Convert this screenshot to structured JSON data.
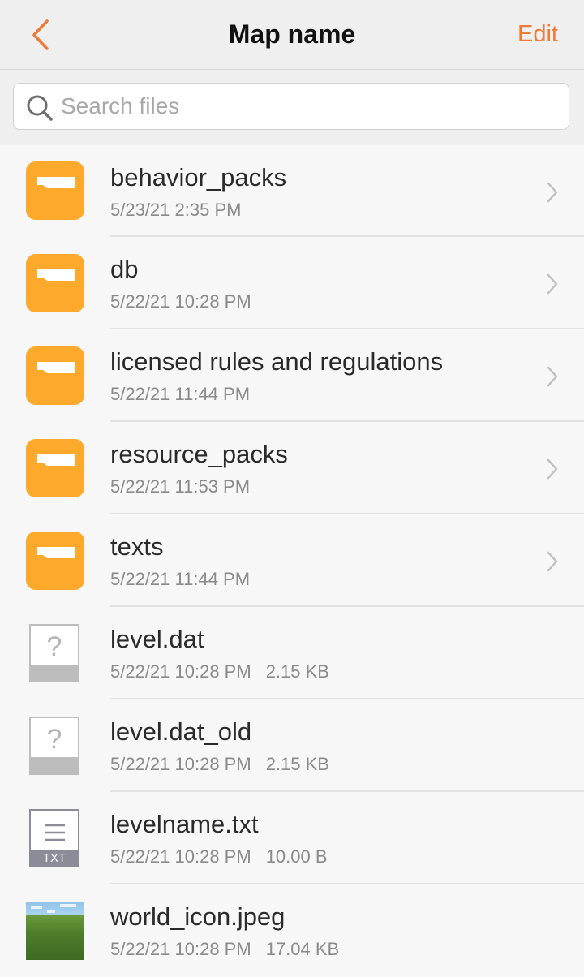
{
  "navbar": {
    "title": "Map name",
    "edit_label": "Edit",
    "accent_color": "#ee7a38"
  },
  "search": {
    "placeholder": "Search files",
    "value": ""
  },
  "files": [
    {
      "name": "behavior_packs",
      "date": "5/23/21 2:35 PM",
      "size": "",
      "type": "folder"
    },
    {
      "name": "db",
      "date": "5/22/21 10:28 PM",
      "size": "",
      "type": "folder"
    },
    {
      "name": "licensed rules and regulations",
      "date": "5/22/21 11:44 PM",
      "size": "",
      "type": "folder"
    },
    {
      "name": "resource_packs",
      "date": "5/22/21 11:53 PM",
      "size": "",
      "type": "folder"
    },
    {
      "name": "texts",
      "date": "5/22/21 11:44 PM",
      "size": "",
      "type": "folder"
    },
    {
      "name": "level.dat",
      "date": "5/22/21 10:28 PM",
      "size": "2.15 KB",
      "type": "unknown",
      "icon_glyph": "?"
    },
    {
      "name": "level.dat_old",
      "date": "5/22/21 10:28 PM",
      "size": "2.15 KB",
      "type": "unknown",
      "icon_glyph": "?"
    },
    {
      "name": "levelname.txt",
      "date": "5/22/21 10:28 PM",
      "size": "10.00 B",
      "type": "text",
      "icon_label": "TXT"
    },
    {
      "name": "world_icon.jpeg",
      "date": "5/22/21 10:28 PM",
      "size": "17.04 KB",
      "type": "image"
    }
  ],
  "icons": {
    "back": "chevron-left-icon",
    "search": "magnifier-icon",
    "folder": "folder-icon",
    "unknown_file": "unknown-file-icon",
    "text_file": "text-file-icon",
    "image": "image-thumbnail",
    "row_chevron": "chevron-right-icon"
  },
  "colors": {
    "folder": "#fdaa2c",
    "unknown_file_band": "#bdbdbd",
    "text_file_band": "#8c8b98"
  }
}
